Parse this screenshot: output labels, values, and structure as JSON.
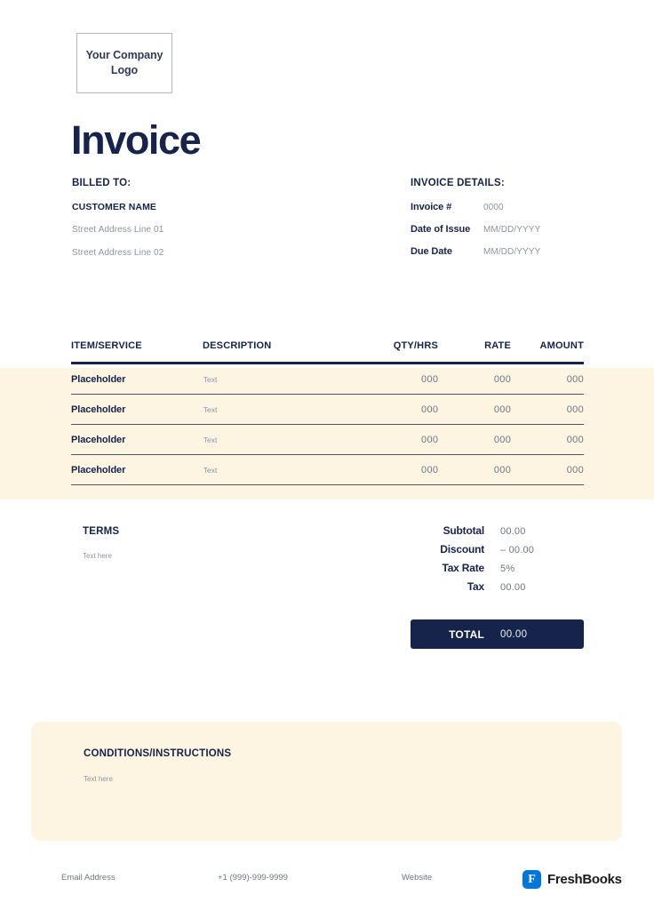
{
  "logo": {
    "placeholder_text": "Your Company Logo"
  },
  "title": "Invoice",
  "billed_to": {
    "heading": "BILLED TO:",
    "customer_name": "CUSTOMER NAME",
    "address_line_1": "Street Address Line 01",
    "address_line_2": "Street Address Line 02"
  },
  "invoice_details": {
    "heading": "INVOICE DETAILS:",
    "rows": [
      {
        "label": "Invoice #",
        "value": "0000"
      },
      {
        "label": "Date of Issue",
        "value": "MM/DD/YYYY"
      },
      {
        "label": "Due Date",
        "value": "MM/DD/YYYY"
      }
    ]
  },
  "items_table": {
    "columns": [
      "ITEM/SERVICE",
      "DESCRIPTION",
      "QTY/HRS",
      "RATE",
      "AMOUNT"
    ],
    "rows": [
      {
        "item": "Placeholder",
        "description": "Text",
        "qty": "000",
        "rate": "000",
        "amount": "000"
      },
      {
        "item": "Placeholder",
        "description": "Text",
        "qty": "000",
        "rate": "000",
        "amount": "000"
      },
      {
        "item": "Placeholder",
        "description": "Text",
        "qty": "000",
        "rate": "000",
        "amount": "000"
      },
      {
        "item": "Placeholder",
        "description": "Text",
        "qty": "000",
        "rate": "000",
        "amount": "000"
      }
    ]
  },
  "terms": {
    "heading": "TERMS",
    "text": "Text here"
  },
  "totals": {
    "rows": [
      {
        "label": "Subtotal",
        "value": "00.00"
      },
      {
        "label": "Discount",
        "value": "– 00.00"
      },
      {
        "label": "Tax Rate",
        "value": "5%"
      },
      {
        "label": "Tax",
        "value": "00.00"
      }
    ],
    "total_label": "TOTAL",
    "total_value": "00.00"
  },
  "conditions": {
    "heading": "CONDITIONS/INSTRUCTIONS",
    "text": "Text here"
  },
  "footer": {
    "email": "Email Address",
    "phone": "+1 (999)-999-9999",
    "website": "Website",
    "brand_name": "FreshBooks",
    "brand_mark_letter": "F"
  },
  "colors": {
    "navy": "#16234a",
    "cream": "#fdf5e2",
    "muted": "#8d93a1",
    "brand_blue": "#0075dd"
  }
}
